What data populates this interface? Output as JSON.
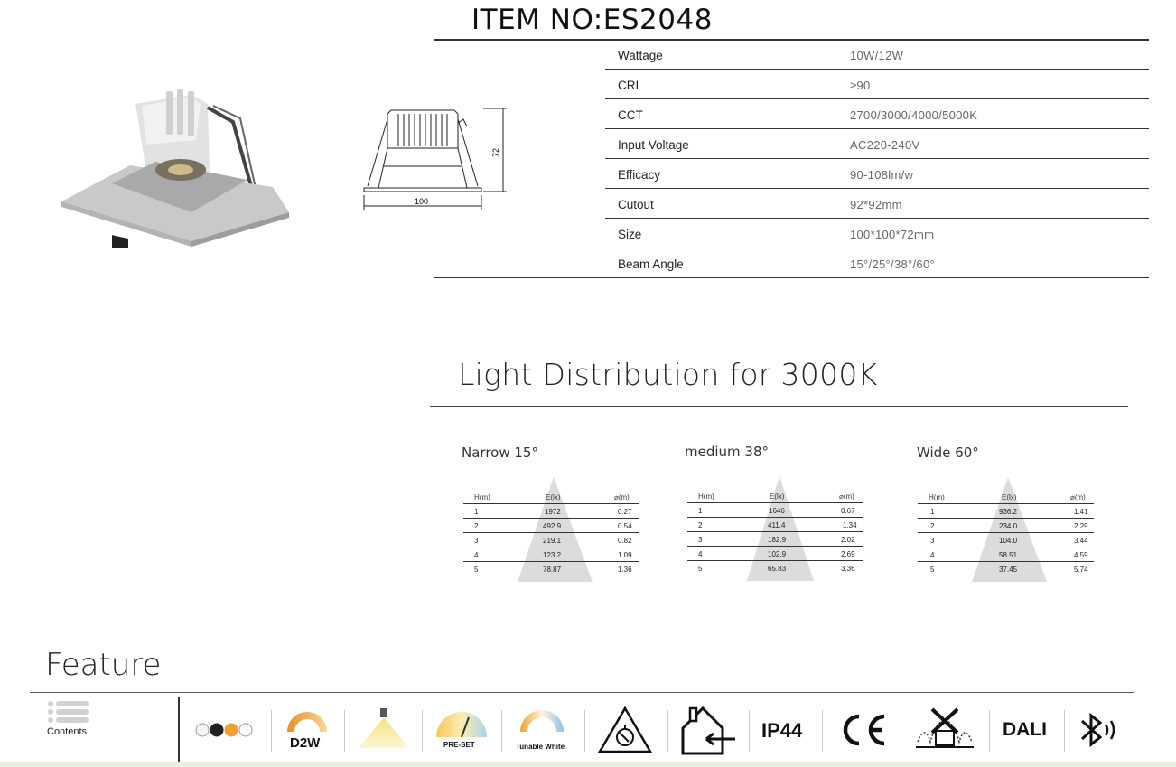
{
  "title": "ITEM NO:ES2048",
  "specs": [
    {
      "label": "Wattage",
      "value": "10W/12W"
    },
    {
      "label": "CRI",
      "value": "≥90"
    },
    {
      "label": "CCT",
      "value": "2700/3000/4000/5000K"
    },
    {
      "label": "Input Voltage",
      "value": "AC220-240V"
    },
    {
      "label": "Efficacy",
      "value": "90-108lm/w"
    },
    {
      "label": "Cutout",
      "value": "92*92mm"
    },
    {
      "label": "Size",
      "value": "100*100*72mm"
    },
    {
      "label": "Beam Angle",
      "value": "15°/25°/38°/60°"
    }
  ],
  "drawing": {
    "width_label": "100",
    "height_label": "72"
  },
  "light_distribution": {
    "title": "Light Distribution for 3000K",
    "columns": [
      "H(m)",
      "E(lx)",
      "⌀(m)"
    ],
    "beams": [
      {
        "title": "Narrow 15°",
        "rows": [
          [
            "1",
            "1972",
            "0.27"
          ],
          [
            "2",
            "492.9",
            "0.54"
          ],
          [
            "3",
            "219.1",
            "0.82"
          ],
          [
            "4",
            "123.2",
            "1.09"
          ],
          [
            "5",
            "78.87",
            "1.36"
          ]
        ]
      },
      {
        "title": "medium 38°",
        "rows": [
          [
            "1",
            "1646",
            "0.67"
          ],
          [
            "2",
            "411.4",
            "1.34"
          ],
          [
            "3",
            "182.9",
            "2.02"
          ],
          [
            "4",
            "102.9",
            "2.69"
          ],
          [
            "5",
            "65.83",
            "3.36"
          ]
        ]
      },
      {
        "title": "Wide 60°",
        "rows": [
          [
            "1",
            "936.2",
            "1.41"
          ],
          [
            "2",
            "234.0",
            "2.29"
          ],
          [
            "3",
            "104.0",
            "3.44"
          ],
          [
            "4",
            "58.51",
            "4.59"
          ],
          [
            "5",
            "37.45",
            "5.74"
          ]
        ]
      }
    ]
  },
  "feature": {
    "title": "Feature",
    "contents_label": "Contents",
    "icons": [
      {
        "name": "color-dots-icon"
      },
      {
        "name": "d2w-icon",
        "label": "D2W"
      },
      {
        "name": "downlight-icon"
      },
      {
        "name": "preset-icon",
        "label": "PRE-SET"
      },
      {
        "name": "tunable-white-icon",
        "label": "Tunable White"
      },
      {
        "name": "dimmer-triangle-icon"
      },
      {
        "name": "indoor-house-icon"
      },
      {
        "name": "ip44-icon",
        "label": "IP44"
      },
      {
        "name": "ce-mark-icon",
        "label": "CE"
      },
      {
        "name": "no-insulation-cover-icon"
      },
      {
        "name": "dali-icon",
        "label": "DALI"
      },
      {
        "name": "bluetooth-icon"
      }
    ]
  },
  "colors": {
    "rule": "#333333",
    "cone": "#dcdcdc",
    "accent_orange": "#f0a030"
  }
}
